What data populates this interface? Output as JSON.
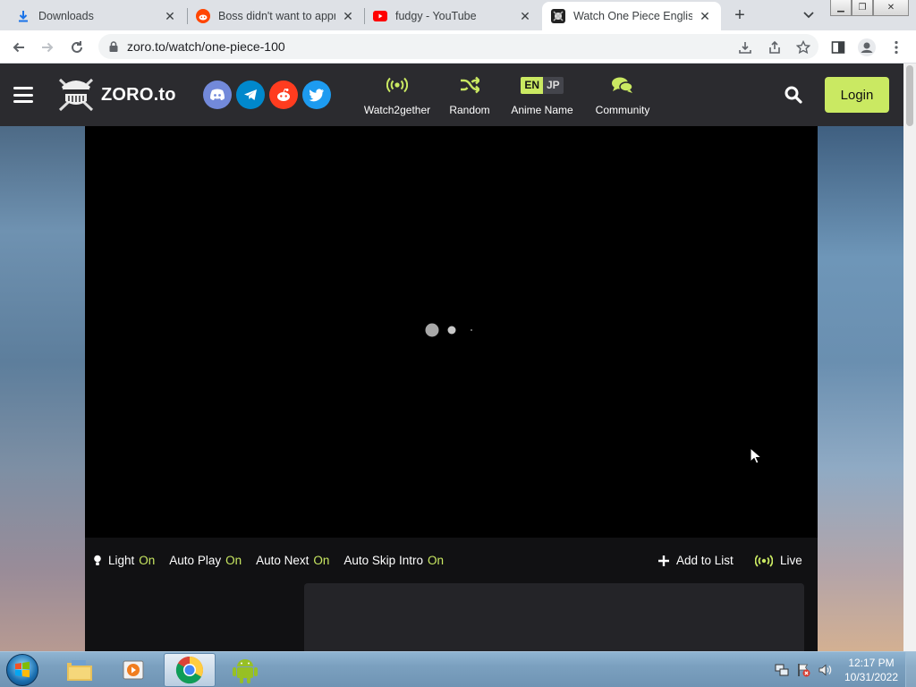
{
  "browser": {
    "tabs": [
      {
        "title": "Downloads",
        "icon": "download-icon"
      },
      {
        "title": "Boss didn't want to appro",
        "icon": "reddit-icon"
      },
      {
        "title": "fudgy - YouTube",
        "icon": "youtube-icon"
      },
      {
        "title": "Watch One Piece English",
        "icon": "zoro-icon",
        "active": true
      }
    ],
    "url": "zoro.to/watch/one-piece-100"
  },
  "site": {
    "logo_text": "ZORO.to",
    "social": [
      "discord-icon",
      "telegram-icon",
      "reddit-icon",
      "twitter-icon"
    ],
    "nav": {
      "watch2gether": "Watch2gether",
      "random": "Random",
      "anime_name": "Anime Name",
      "community": "Community",
      "lang_en": "EN",
      "lang_jp": "JP"
    },
    "login": "Login"
  },
  "player_controls": {
    "light_label": "Light",
    "light_state": "On",
    "autoplay_label": "Auto Play",
    "autoplay_state": "On",
    "autonext_label": "Auto Next",
    "autonext_state": "On",
    "autoskip_label": "Auto Skip Intro",
    "autoskip_state": "On",
    "add_to_list": "Add to List",
    "live": "Live"
  },
  "taskbar": {
    "apps": [
      "file-explorer-icon",
      "media-player-icon",
      "chrome-icon",
      "android-icon"
    ],
    "time": "12:17 PM",
    "date": "10/31/2022"
  },
  "colors": {
    "accent": "#cae962",
    "header_bg": "#2b2b2f"
  }
}
